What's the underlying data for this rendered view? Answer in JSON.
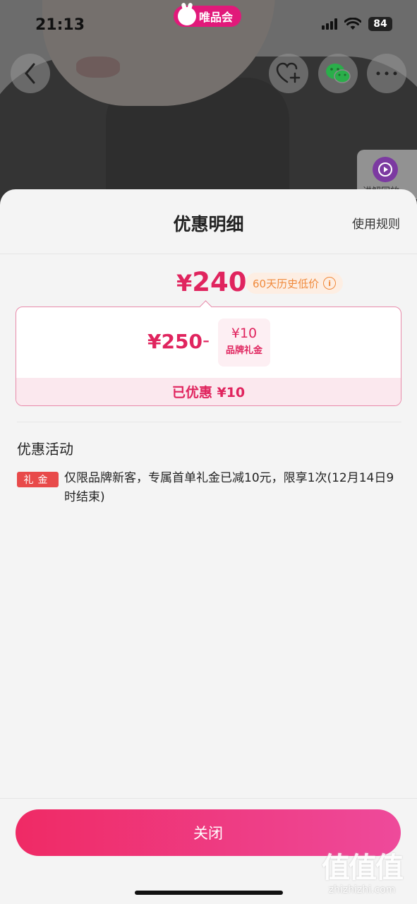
{
  "status_bar": {
    "time": "21:13",
    "battery": "84",
    "brand": "唯品会"
  },
  "nav": {
    "back_icon": "chevron-left-icon",
    "favorite_icon": "heart-plus-icon",
    "wechat_icon": "wechat-icon",
    "more_icon": "more-dots-icon"
  },
  "replay": {
    "label": "讲解回放"
  },
  "sheet": {
    "title": "优惠明细",
    "rules_link": "使用规则",
    "final_price_symbol": "¥",
    "final_price": "240",
    "history_badge": "60天历史低价",
    "calc": {
      "original_price": "¥250",
      "minus": "-",
      "coupon_amount": "¥10",
      "coupon_name": "品牌礼金",
      "saved": "已优惠 ¥10"
    },
    "section_title": "优惠活动",
    "promo": {
      "tag": "礼金",
      "text": "仅限品牌新客，专属首单礼金已减10元，限享1次(12月14日9时结束)"
    },
    "close_button": "关闭"
  },
  "watermark": {
    "logo": "值值值",
    "url": "zhizhizhi.com"
  },
  "colors": {
    "accent": "#e0245e",
    "button_start": "#ef2a65",
    "button_end": "#ee4a9b",
    "history": "#f08a3c"
  }
}
